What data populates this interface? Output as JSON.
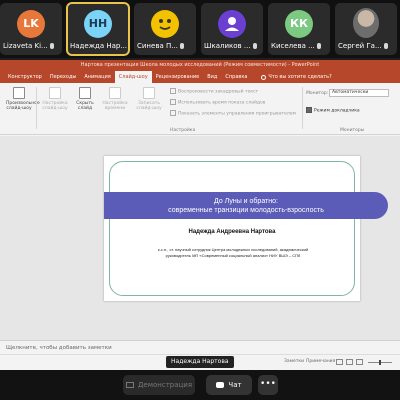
{
  "participants": [
    {
      "initials": "LK",
      "name": "Lizaveta Ki...",
      "color": "#e8773a",
      "active": false
    },
    {
      "initials": "НН",
      "name": "Надежда Нар...",
      "color": "#7bd3f7",
      "active": true
    },
    {
      "initials": "",
      "name": "Синева П...",
      "color": "#f2c200",
      "active": false
    },
    {
      "initials": "",
      "name": "Шкаликов ...",
      "color": "#6b3fd0",
      "active": false
    },
    {
      "initials": "КК",
      "name": "Киселева ...",
      "color": "#7cc982",
      "active": false
    },
    {
      "initials": "",
      "name": "Сергей Га...",
      "color": "#777777",
      "active": false
    }
  ],
  "ppt": {
    "window_title": "Нартова презентация Школа молодых исследований (Режим совместимости) - PowerPoint",
    "tabs": [
      "Конструктор",
      "Переходы",
      "Анимация",
      "Слайд-шоу",
      "Рецензирование",
      "Вид",
      "Справка"
    ],
    "selected_tab": "Слайд-шоу",
    "tell_me": "Что вы хотите сделать?",
    "ribbon": {
      "buttons": [
        "Произвольное слайд-шоу",
        "Настройка слайд-шоу",
        "Скрыть слайд",
        "Настройка времени",
        "Записать слайд-шоу"
      ],
      "checkboxes": [
        "Воспроизвести закадровый текст",
        "Использовать время показа слайдов",
        "Показать элементы управления проигрывателем"
      ],
      "group_label": "Настройка",
      "monitor_label": "Монитор:",
      "monitor_value": "Автоматически",
      "presenter_view": "Режим докладчика",
      "monitors_group": "Мониторы"
    },
    "slide": {
      "title_line1": "До Луны и обратно:",
      "title_line2": "современные транзиции молодость-взрослость",
      "author": "Надежда Андреевна Нартова",
      "affiliation": "к.с.н., ст. научный сотрудник Центра молодежных исследований, академический руководитель МП «Современный социальный анализ» НИУ ВШЭ – СПб"
    },
    "notes_placeholder": "Щелкните, чтобы добавить заметки",
    "speaker_label": "Надежда Нартова",
    "status_notes": "Заметки",
    "status_comments": "Примечания"
  },
  "controls": {
    "demo_label": "Демонстрация",
    "chat_label": "Чат",
    "more_label": "•••"
  },
  "colors": {
    "ppt_accent": "#b7472a",
    "slide_bar": "#5b5bb8",
    "slide_frame": "#7fb69d",
    "active_tile": "#e8c44a"
  }
}
